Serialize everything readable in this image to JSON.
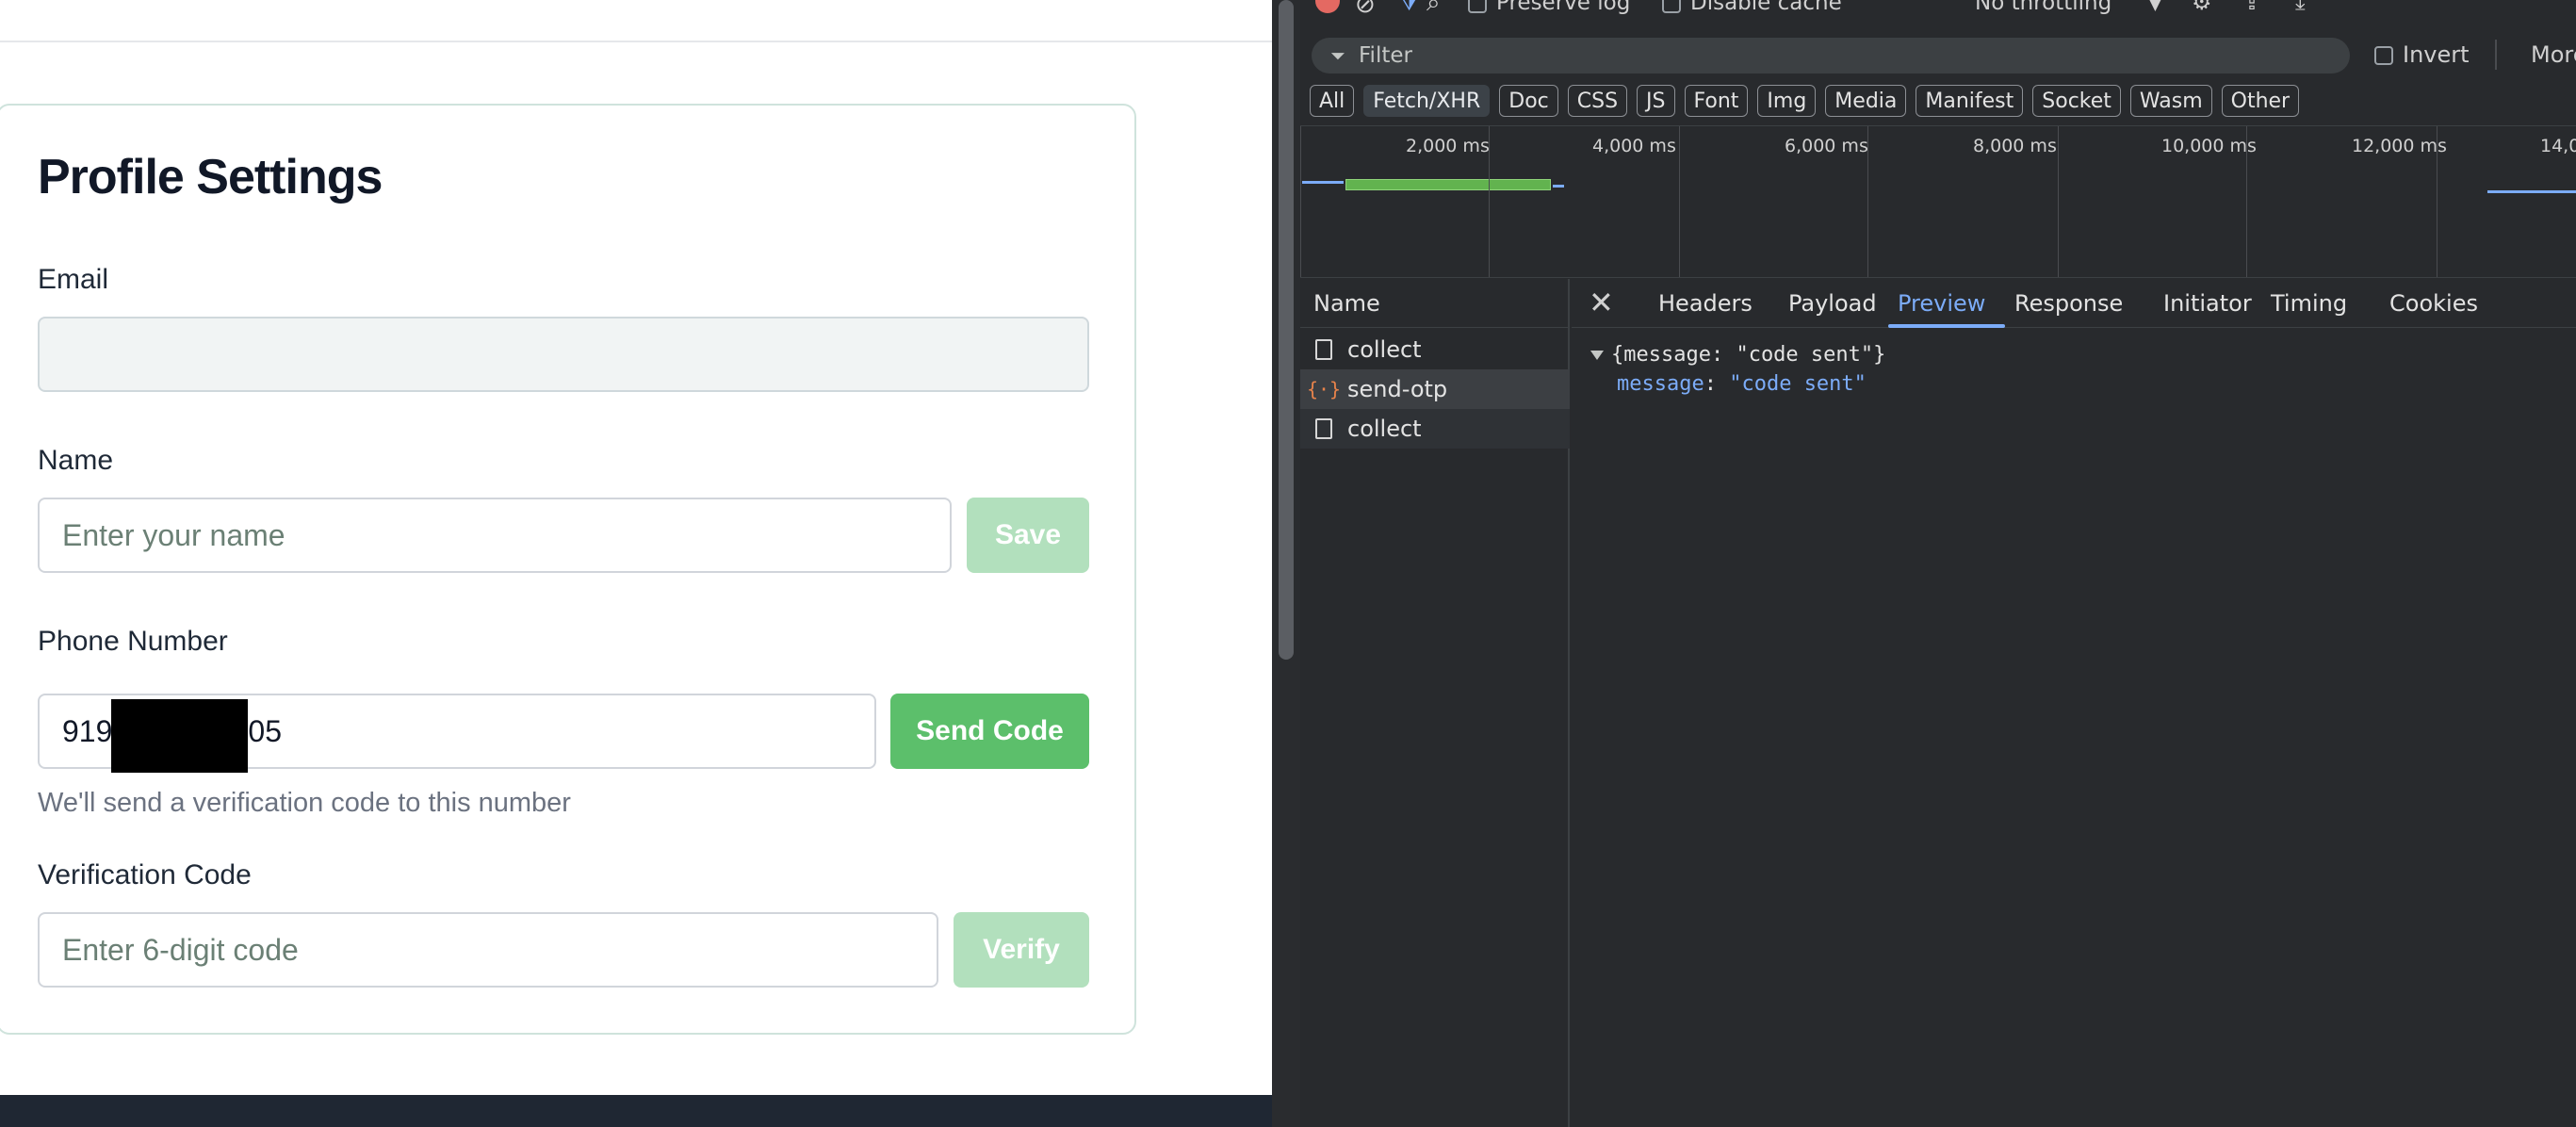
{
  "profile": {
    "title": "Profile Settings",
    "email": {
      "label": "Email",
      "value": ""
    },
    "name": {
      "label": "Name",
      "placeholder": "Enter your name",
      "save_label": "Save"
    },
    "phone": {
      "label": "Phone Number",
      "value_prefix": "919",
      "value_suffix": "05",
      "send_label": "Send Code",
      "helper": "We'll send a verification code to this number"
    },
    "verification": {
      "label": "Verification Code",
      "placeholder": "Enter 6-digit code",
      "verify_label": "Verify"
    }
  },
  "devtools": {
    "toolbar": {
      "preserve_log": "Preserve log",
      "disable_cache": "Disable cache",
      "throttling": "No throttling"
    },
    "filter_placeholder": "Filter",
    "invert_label": "Invert",
    "more_label": "More",
    "type_filters": [
      "All",
      "Fetch/XHR",
      "Doc",
      "CSS",
      "JS",
      "Font",
      "Img",
      "Media",
      "Manifest",
      "Socket",
      "Wasm",
      "Other"
    ],
    "selected_filter": "Fetch/XHR",
    "timeline_ticks": [
      "2,000 ms",
      "4,000 ms",
      "6,000 ms",
      "8,000 ms",
      "10,000 ms",
      "12,000 ms",
      "14,0"
    ],
    "table_header": "Name",
    "requests": [
      {
        "name": "collect",
        "type": "document"
      },
      {
        "name": "send-otp",
        "type": "xhr"
      },
      {
        "name": "collect",
        "type": "document"
      }
    ],
    "detail_tabs": [
      "Headers",
      "Payload",
      "Preview",
      "Response",
      "Initiator",
      "Timing",
      "Cookies"
    ],
    "active_tab": "Preview",
    "preview": {
      "summary": "{message: \"code sent\"}",
      "key": "message",
      "value": "\"code sent\""
    }
  },
  "colors": {
    "accent_green": "#5cbf6b",
    "accent_green_faded": "#b2e0bd",
    "devtools_bg": "#282a2d",
    "devtools_accent": "#7cacf8"
  }
}
